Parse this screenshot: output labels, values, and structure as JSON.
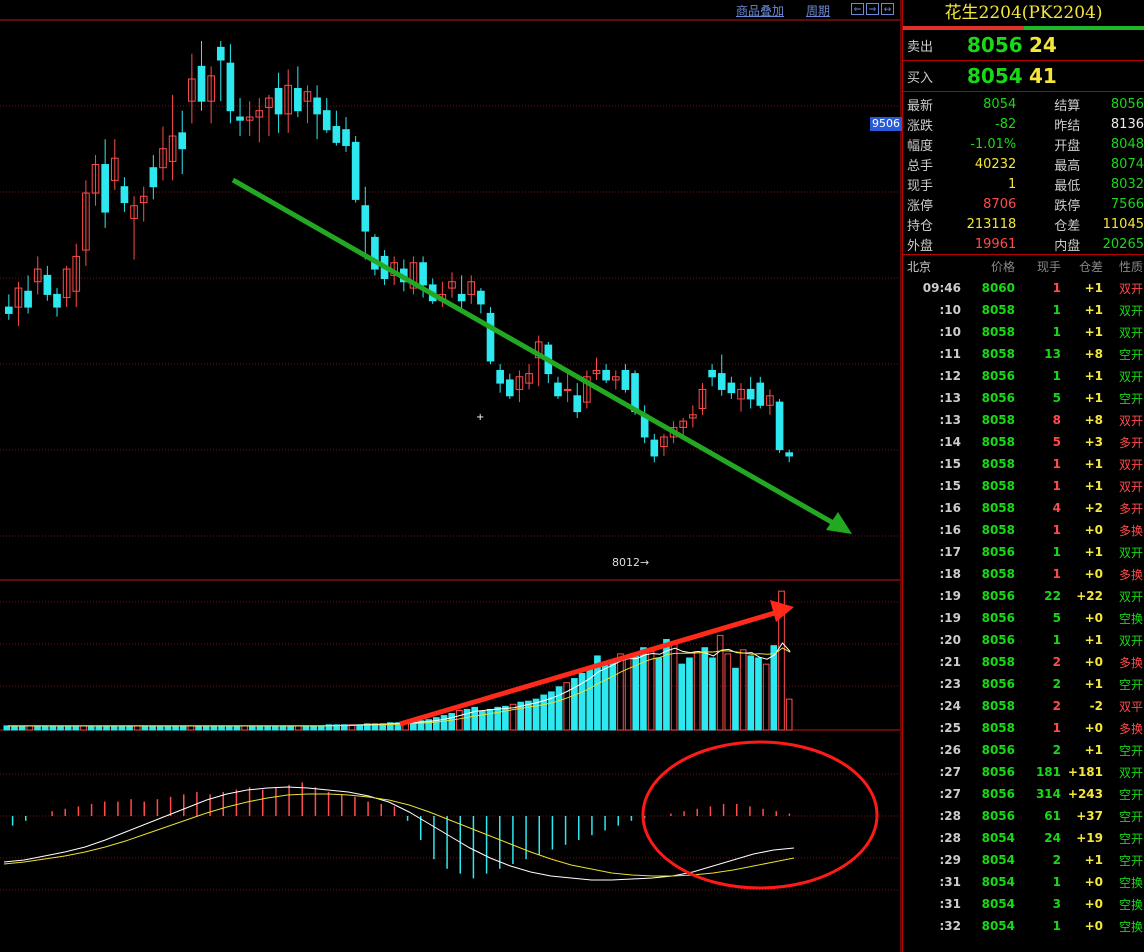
{
  "toolbar": {
    "overlay_label": "商品叠加",
    "period_label": "周期",
    "nav_prev": "⇐",
    "nav_next": "⇒",
    "nav_play": "↔"
  },
  "chart_labels": {
    "price_tag": "9506",
    "low_marker": "8012→"
  },
  "chart_data": {
    "type": "candlestick",
    "ylim": [
      7970,
      9700
    ],
    "candles": [
      [
        8800,
        8840,
        8760,
        8780
      ],
      [
        8800,
        8880,
        8740,
        8860
      ],
      [
        8850,
        8900,
        8780,
        8800
      ],
      [
        8880,
        8960,
        8840,
        8920
      ],
      [
        8900,
        8930,
        8820,
        8840
      ],
      [
        8840,
        8860,
        8770,
        8800
      ],
      [
        8830,
        8930,
        8800,
        8920
      ],
      [
        8850,
        9000,
        8800,
        8960
      ],
      [
        8980,
        9200,
        8930,
        9160
      ],
      [
        9160,
        9280,
        9120,
        9250
      ],
      [
        9250,
        9330,
        9050,
        9100
      ],
      [
        9200,
        9330,
        9170,
        9270
      ],
      [
        9180,
        9210,
        9100,
        9130
      ],
      [
        9080,
        9150,
        8950,
        9120
      ],
      [
        9130,
        9180,
        9070,
        9150
      ],
      [
        9240,
        9280,
        9140,
        9180
      ],
      [
        9240,
        9370,
        9200,
        9300
      ],
      [
        9260,
        9470,
        9200,
        9340
      ],
      [
        9350,
        9420,
        9220,
        9300
      ],
      [
        9450,
        9600,
        9380,
        9520
      ],
      [
        9560,
        9640,
        9420,
        9450
      ],
      [
        9450,
        9560,
        9380,
        9530
      ],
      [
        9620,
        9640,
        9450,
        9580
      ],
      [
        9570,
        9630,
        9380,
        9420
      ],
      [
        9400,
        9460,
        9340,
        9390
      ],
      [
        9390,
        9450,
        9340,
        9400
      ],
      [
        9400,
        9460,
        9320,
        9420
      ],
      [
        9430,
        9470,
        9340,
        9460
      ],
      [
        9490,
        9540,
        9350,
        9410
      ],
      [
        9410,
        9550,
        9350,
        9500
      ],
      [
        9490,
        9560,
        9400,
        9420
      ],
      [
        9450,
        9500,
        9380,
        9480
      ],
      [
        9460,
        9500,
        9330,
        9410
      ],
      [
        9420,
        9460,
        9350,
        9360
      ],
      [
        9370,
        9420,
        9310,
        9320
      ],
      [
        9360,
        9400,
        9290,
        9310
      ],
      [
        9320,
        9340,
        9130,
        9140
      ],
      [
        9120,
        9180,
        8950,
        9040
      ],
      [
        9020,
        9030,
        8900,
        8920
      ],
      [
        8960,
        8980,
        8870,
        8890
      ],
      [
        8900,
        8960,
        8870,
        8940
      ],
      [
        8920,
        8950,
        8850,
        8880
      ],
      [
        8860,
        8960,
        8840,
        8940
      ],
      [
        8940,
        8960,
        8830,
        8870
      ],
      [
        8870,
        8890,
        8810,
        8820
      ],
      [
        8820,
        8880,
        8800,
        8840
      ],
      [
        8860,
        8910,
        8830,
        8880
      ],
      [
        8840,
        8900,
        8790,
        8820
      ],
      [
        8840,
        8900,
        8810,
        8880
      ],
      [
        8850,
        8860,
        8780,
        8810
      ],
      [
        8780,
        8800,
        8620,
        8630
      ],
      [
        8600,
        8620,
        8530,
        8560
      ],
      [
        8570,
        8590,
        8510,
        8520
      ],
      [
        8540,
        8600,
        8500,
        8580
      ],
      [
        8560,
        8620,
        8540,
        8590
      ],
      [
        8640,
        8710,
        8550,
        8690
      ],
      [
        8680,
        8690,
        8560,
        8590
      ],
      [
        8560,
        8580,
        8510,
        8520
      ],
      [
        8540,
        8600,
        8500,
        8540
      ],
      [
        8520,
        8560,
        8450,
        8470
      ],
      [
        8500,
        8600,
        8480,
        8580
      ],
      [
        8590,
        8640,
        8570,
        8600
      ],
      [
        8600,
        8620,
        8560,
        8570
      ],
      [
        8570,
        8600,
        8540,
        8580
      ],
      [
        8600,
        8620,
        8530,
        8540
      ],
      [
        8590,
        8600,
        8460,
        8470
      ],
      [
        8460,
        8490,
        8370,
        8390
      ],
      [
        8380,
        8400,
        8310,
        8330
      ],
      [
        8360,
        8400,
        8330,
        8390
      ],
      [
        8390,
        8440,
        8370,
        8420
      ],
      [
        8420,
        8450,
        8390,
        8440
      ],
      [
        8450,
        8490,
        8420,
        8460
      ],
      [
        8480,
        8560,
        8460,
        8540
      ],
      [
        8600,
        8620,
        8550,
        8580
      ],
      [
        8590,
        8650,
        8520,
        8540
      ],
      [
        8560,
        8580,
        8510,
        8530
      ],
      [
        8510,
        8560,
        8470,
        8540
      ],
      [
        8540,
        8580,
        8480,
        8510
      ],
      [
        8560,
        8580,
        8480,
        8490
      ],
      [
        8490,
        8540,
        8460,
        8520
      ],
      [
        8500,
        8510,
        8340,
        8350
      ],
      [
        8340,
        8350,
        8310,
        8330
      ]
    ],
    "volume_ma_note": "",
    "volumes": [
      4,
      4,
      4,
      4,
      4,
      4,
      4,
      4,
      4,
      4,
      4,
      4,
      4,
      4,
      4,
      4,
      4,
      4,
      4,
      4,
      4,
      4,
      4,
      4,
      4,
      4,
      4,
      4,
      4,
      4,
      4,
      4,
      4,
      4,
      4,
      4,
      4,
      4,
      4,
      4,
      4,
      4,
      5,
      5,
      5,
      5,
      5,
      6,
      6,
      6,
      7,
      7,
      8,
      8,
      9,
      10,
      12,
      14,
      16,
      19,
      20,
      22,
      18,
      20,
      22,
      23,
      25,
      27,
      28,
      30,
      34,
      37,
      42,
      46,
      50,
      55,
      60,
      72,
      63,
      68,
      74,
      70,
      72,
      80,
      76,
      70,
      88,
      84,
      64,
      70,
      76,
      80,
      70,
      92,
      74,
      60,
      78,
      72,
      70,
      64,
      82,
      135,
      30
    ],
    "volume_colors": [],
    "macd_hist": [
      -4,
      -2,
      0,
      2,
      3,
      4,
      5,
      6,
      6,
      7,
      6,
      7,
      8,
      9,
      10,
      9,
      10,
      11,
      12,
      11,
      12,
      13,
      14,
      12,
      10,
      9,
      8,
      6,
      5,
      4,
      -2,
      -10,
      -18,
      -22,
      -24,
      -26,
      -24,
      -22,
      -20,
      -18,
      -16,
      -14,
      -12,
      -10,
      -8,
      -6,
      -4,
      -2,
      -1,
      0,
      1,
      2,
      3,
      4,
      5,
      5,
      4,
      3,
      2,
      1
    ],
    "macd_dif": [
      -20,
      -18,
      -14,
      -10,
      -5,
      2,
      10,
      18,
      26,
      34,
      42,
      48,
      52,
      54,
      55,
      54,
      52,
      50,
      46,
      40,
      30,
      18,
      6,
      -6,
      -16,
      -24,
      -30,
      -34,
      -36,
      -38,
      -38,
      -37,
      -36,
      -34,
      -30,
      -24,
      -18,
      -12,
      -8,
      -6
    ],
    "macd_dea": [
      -22,
      -20,
      -17,
      -14,
      -10,
      -5,
      1,
      8,
      15,
      22,
      29,
      35,
      40,
      44,
      47,
      48,
      48,
      47,
      45,
      42,
      37,
      30,
      22,
      14,
      6,
      -2,
      -10,
      -17,
      -23,
      -27,
      -31,
      -33,
      -34,
      -34,
      -33,
      -31,
      -28,
      -24,
      -20,
      -16
    ]
  },
  "quote": {
    "title": "花生2204(PK2204)",
    "sell_label": "卖出",
    "sell_price": "8056",
    "sell_vol": "24",
    "buy_label": "买入",
    "buy_price": "8054",
    "buy_vol": "41",
    "stats": [
      {
        "k": "最新",
        "v": "8054",
        "vc": "c-green",
        "k2": "结算",
        "v2": "8056",
        "v2c": "c-green"
      },
      {
        "k": "涨跌",
        "v": "-82",
        "vc": "c-green",
        "k2": "昨结",
        "v2": "8136",
        "v2c": "c-white"
      },
      {
        "k": "幅度",
        "v": "-1.01%",
        "vc": "c-green",
        "k2": "开盘",
        "v2": "8048",
        "v2c": "c-green"
      },
      {
        "k": "总手",
        "v": "40232",
        "vc": "c-yellow",
        "k2": "最高",
        "v2": "8074",
        "v2c": "c-green"
      },
      {
        "k": "现手",
        "v": "1",
        "vc": "c-yellow",
        "k2": "最低",
        "v2": "8032",
        "v2c": "c-green"
      },
      {
        "k": "涨停",
        "v": "8706",
        "vc": "c-red",
        "k2": "跌停",
        "v2": "7566",
        "v2c": "c-green"
      },
      {
        "k": "持仓",
        "v": "213118",
        "vc": "c-yellow",
        "k2": "仓差",
        "v2": "11045",
        "v2c": "c-yellow"
      },
      {
        "k": "外盘",
        "v": "19961",
        "vc": "c-red",
        "k2": "内盘",
        "v2": "20265",
        "v2c": "c-green"
      }
    ],
    "tick_headers": [
      "北京",
      "价格",
      "现手",
      "仓差",
      "性质"
    ],
    "ticks": [
      {
        "t": "09:46",
        "p": "8060",
        "pc": "c-green",
        "v": "1",
        "vc": "c-red",
        "o": "+1",
        "oc": "c-yellow",
        "n": "双开",
        "nc": "c-red"
      },
      {
        "t": ":10",
        "p": "8058",
        "pc": "c-green",
        "v": "1",
        "vc": "c-green",
        "o": "+1",
        "oc": "c-yellow",
        "n": "双开",
        "nc": "c-green"
      },
      {
        "t": ":10",
        "p": "8058",
        "pc": "c-green",
        "v": "1",
        "vc": "c-green",
        "o": "+1",
        "oc": "c-yellow",
        "n": "双开",
        "nc": "c-green"
      },
      {
        "t": ":11",
        "p": "8058",
        "pc": "c-green",
        "v": "13",
        "vc": "c-green",
        "o": "+8",
        "oc": "c-yellow",
        "n": "空开",
        "nc": "c-green"
      },
      {
        "t": ":12",
        "p": "8056",
        "pc": "c-green",
        "v": "1",
        "vc": "c-green",
        "o": "+1",
        "oc": "c-yellow",
        "n": "双开",
        "nc": "c-green"
      },
      {
        "t": ":13",
        "p": "8056",
        "pc": "c-green",
        "v": "5",
        "vc": "c-green",
        "o": "+1",
        "oc": "c-yellow",
        "n": "空开",
        "nc": "c-green"
      },
      {
        "t": ":13",
        "p": "8058",
        "pc": "c-green",
        "v": "8",
        "vc": "c-red",
        "o": "+8",
        "oc": "c-yellow",
        "n": "双开",
        "nc": "c-red"
      },
      {
        "t": ":14",
        "p": "8058",
        "pc": "c-green",
        "v": "5",
        "vc": "c-red",
        "o": "+3",
        "oc": "c-yellow",
        "n": "多开",
        "nc": "c-red"
      },
      {
        "t": ":15",
        "p": "8058",
        "pc": "c-green",
        "v": "1",
        "vc": "c-red",
        "o": "+1",
        "oc": "c-yellow",
        "n": "双开",
        "nc": "c-red"
      },
      {
        "t": ":15",
        "p": "8058",
        "pc": "c-green",
        "v": "1",
        "vc": "c-red",
        "o": "+1",
        "oc": "c-yellow",
        "n": "双开",
        "nc": "c-red"
      },
      {
        "t": ":16",
        "p": "8058",
        "pc": "c-green",
        "v": "4",
        "vc": "c-red",
        "o": "+2",
        "oc": "c-yellow",
        "n": "多开",
        "nc": "c-red"
      },
      {
        "t": ":16",
        "p": "8058",
        "pc": "c-green",
        "v": "1",
        "vc": "c-red",
        "o": "+0",
        "oc": "c-yellow",
        "n": "多换",
        "nc": "c-red"
      },
      {
        "t": ":17",
        "p": "8056",
        "pc": "c-green",
        "v": "1",
        "vc": "c-green",
        "o": "+1",
        "oc": "c-yellow",
        "n": "双开",
        "nc": "c-green"
      },
      {
        "t": ":18",
        "p": "8058",
        "pc": "c-green",
        "v": "1",
        "vc": "c-red",
        "o": "+0",
        "oc": "c-yellow",
        "n": "多换",
        "nc": "c-red"
      },
      {
        "t": ":19",
        "p": "8056",
        "pc": "c-green",
        "v": "22",
        "vc": "c-green",
        "o": "+22",
        "oc": "c-yellow",
        "n": "双开",
        "nc": "c-green"
      },
      {
        "t": ":19",
        "p": "8056",
        "pc": "c-green",
        "v": "5",
        "vc": "c-green",
        "o": "+0",
        "oc": "c-yellow",
        "n": "空换",
        "nc": "c-green"
      },
      {
        "t": ":20",
        "p": "8056",
        "pc": "c-green",
        "v": "1",
        "vc": "c-green",
        "o": "+1",
        "oc": "c-yellow",
        "n": "双开",
        "nc": "c-green"
      },
      {
        "t": ":21",
        "p": "8058",
        "pc": "c-green",
        "v": "2",
        "vc": "c-red",
        "o": "+0",
        "oc": "c-yellow",
        "n": "多换",
        "nc": "c-red"
      },
      {
        "t": ":23",
        "p": "8056",
        "pc": "c-green",
        "v": "2",
        "vc": "c-green",
        "o": "+1",
        "oc": "c-yellow",
        "n": "空开",
        "nc": "c-green"
      },
      {
        "t": ":24",
        "p": "8058",
        "pc": "c-green",
        "v": "2",
        "vc": "c-red",
        "o": "-2",
        "oc": "c-yellow",
        "n": "双平",
        "nc": "c-red"
      },
      {
        "t": ":25",
        "p": "8058",
        "pc": "c-green",
        "v": "1",
        "vc": "c-red",
        "o": "+0",
        "oc": "c-yellow",
        "n": "多换",
        "nc": "c-red"
      },
      {
        "t": ":26",
        "p": "8056",
        "pc": "c-green",
        "v": "2",
        "vc": "c-green",
        "o": "+1",
        "oc": "c-yellow",
        "n": "空开",
        "nc": "c-green"
      },
      {
        "t": ":27",
        "p": "8056",
        "pc": "c-green",
        "v": "181",
        "vc": "c-green",
        "o": "+181",
        "oc": "c-yellow",
        "n": "双开",
        "nc": "c-green"
      },
      {
        "t": ":27",
        "p": "8056",
        "pc": "c-green",
        "v": "314",
        "vc": "c-green",
        "o": "+243",
        "oc": "c-yellow",
        "n": "空开",
        "nc": "c-green"
      },
      {
        "t": ":28",
        "p": "8056",
        "pc": "c-green",
        "v": "61",
        "vc": "c-green",
        "o": "+37",
        "oc": "c-yellow",
        "n": "空开",
        "nc": "c-green"
      },
      {
        "t": ":28",
        "p": "8054",
        "pc": "c-green",
        "v": "24",
        "vc": "c-green",
        "o": "+19",
        "oc": "c-yellow",
        "n": "空开",
        "nc": "c-green"
      },
      {
        "t": ":29",
        "p": "8054",
        "pc": "c-green",
        "v": "2",
        "vc": "c-green",
        "o": "+1",
        "oc": "c-yellow",
        "n": "空开",
        "nc": "c-green"
      },
      {
        "t": ":31",
        "p": "8054",
        "pc": "c-green",
        "v": "1",
        "vc": "c-green",
        "o": "+0",
        "oc": "c-yellow",
        "n": "空换",
        "nc": "c-green"
      },
      {
        "t": ":31",
        "p": "8054",
        "pc": "c-green",
        "v": "3",
        "vc": "c-green",
        "o": "+0",
        "oc": "c-yellow",
        "n": "空换",
        "nc": "c-green"
      },
      {
        "t": ":32",
        "p": "8054",
        "pc": "c-green",
        "v": "1",
        "vc": "c-green",
        "o": "+0",
        "oc": "c-yellow",
        "n": "空换",
        "nc": "c-green"
      }
    ]
  },
  "colors": {
    "up": "#ff4b4b",
    "down": "#2ee8f0",
    "grid": "#7a1010",
    "trend_down": "#22a822",
    "trend_up": "#ff2a1a",
    "ma_white": "#ffffff",
    "ma_yellow": "#e8e030"
  }
}
